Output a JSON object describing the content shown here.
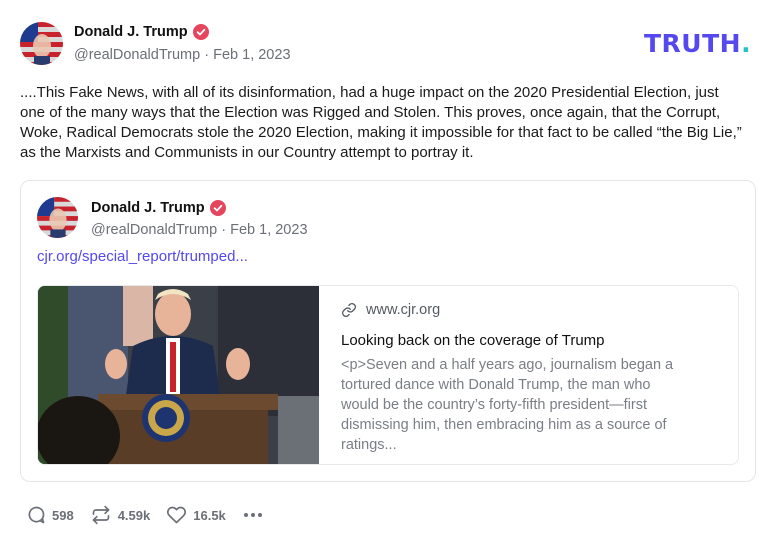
{
  "post": {
    "author_name": "Donald J. Trump",
    "handle": "@realDonaldTrump",
    "separator": "·",
    "date": "Feb 1, 2023",
    "text": "....This Fake News, with all of its disinformation, had a huge impact on the 2020 Presidential Election, just one of the many ways that the Election was Rigged and Stolen. This proves, once again, that the Corrupt, Woke, Radical Democrats stole the 2020 Election, making it impossible for that fact to be called “the Big Lie,” as the Marxists and Communists in our Country attempt to portray it."
  },
  "brand": {
    "logo_text": "TRUTH",
    "logo_dot": ".",
    "logo_color": "#5448ee",
    "dot_color": "#21c3c3"
  },
  "quote": {
    "author_name": "Donald J. Trump",
    "handle": "@realDonaldTrump",
    "separator": "·",
    "date": "Feb 1, 2023",
    "link_text": "cjr.org/special_report/trumped...",
    "link_color": "#5448ee"
  },
  "preview": {
    "domain": "www.cjr.org",
    "title": "Looking back on the coverage of Trump",
    "description": "<p>Seven and a half years ago, journalism began a tortured dance with Donald Trump, the man who would be the country’s forty-fifth president—first dismissing him, then embracing him as a source of ratings..."
  },
  "actions": {
    "replies": "598",
    "reposts": "4.59k",
    "likes": "16.5k",
    "more_icon": "ellipsis-icon"
  },
  "colors": {
    "verified_badge": "#e5465e",
    "muted_text": "#6b6f76"
  }
}
